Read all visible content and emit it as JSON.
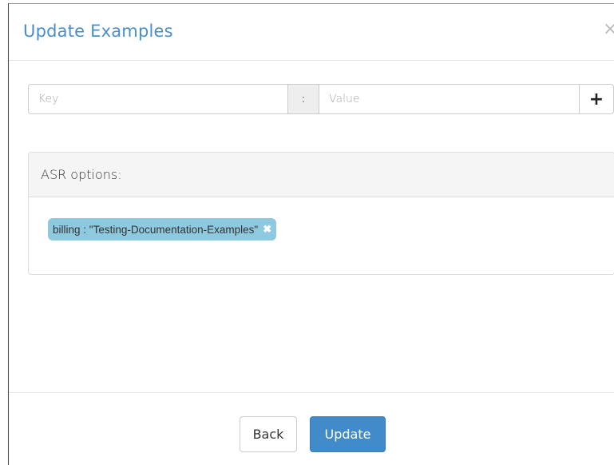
{
  "modal": {
    "title": "Update Examples",
    "close_icon": "close-icon"
  },
  "kv_input": {
    "key_placeholder": "Key",
    "separator": ":",
    "value_placeholder": "Value",
    "add_icon": "plus-icon",
    "add_label": "+"
  },
  "asr_panel": {
    "heading": "ASR options:",
    "tags": [
      {
        "label": "billing : \"Testing-Documentation-Examples\"",
        "remove_icon": "remove-icon"
      }
    ]
  },
  "footer": {
    "back_label": "Back",
    "update_label": "Update"
  },
  "colors": {
    "title": "#4a8fc9",
    "primary_button": "#428bca",
    "tag_background": "#8fc9e0"
  }
}
